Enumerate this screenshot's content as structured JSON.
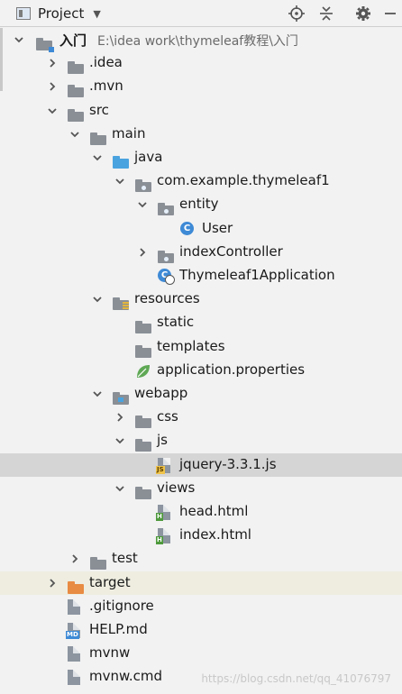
{
  "header": {
    "title": "Project",
    "icons": [
      "crosshair-icon",
      "collapse-icon",
      "gear-icon",
      "minimize-icon"
    ]
  },
  "tree": [
    {
      "label": "入门",
      "path": "E:\\idea work\\thymeleaf教程\\入门",
      "depth": 0,
      "expanded": true,
      "icon": "module-folder"
    },
    {
      "label": ".idea",
      "depth": 1,
      "expanded": false,
      "icon": "folder"
    },
    {
      "label": ".mvn",
      "depth": 1,
      "expanded": false,
      "icon": "folder"
    },
    {
      "label": "src",
      "depth": 1,
      "expanded": true,
      "icon": "folder"
    },
    {
      "label": "main",
      "depth": 2,
      "expanded": true,
      "icon": "folder"
    },
    {
      "label": "java",
      "depth": 3,
      "expanded": true,
      "icon": "source-folder"
    },
    {
      "label": "com.example.thymeleaf1",
      "depth": 4,
      "expanded": true,
      "icon": "package"
    },
    {
      "label": "entity",
      "depth": 5,
      "expanded": true,
      "icon": "package"
    },
    {
      "label": "User",
      "depth": 6,
      "icon": "class"
    },
    {
      "label": "indexController",
      "depth": 5,
      "expanded": false,
      "icon": "package"
    },
    {
      "label": "Thymeleaf1Application",
      "depth": 5,
      "icon": "spring-class"
    },
    {
      "label": "resources",
      "depth": 3,
      "expanded": true,
      "icon": "resources-folder"
    },
    {
      "label": "static",
      "depth": 4,
      "icon": "folder"
    },
    {
      "label": "templates",
      "depth": 4,
      "icon": "folder"
    },
    {
      "label": "application.properties",
      "depth": 4,
      "icon": "spring-leaf"
    },
    {
      "label": "webapp",
      "depth": 3,
      "expanded": true,
      "icon": "web-folder"
    },
    {
      "label": "css",
      "depth": 4,
      "expanded": false,
      "icon": "folder"
    },
    {
      "label": "js",
      "depth": 4,
      "expanded": true,
      "icon": "folder"
    },
    {
      "label": "jquery-3.3.1.js",
      "depth": 5,
      "icon": "js-file",
      "selected": true
    },
    {
      "label": "views",
      "depth": 4,
      "expanded": true,
      "icon": "folder"
    },
    {
      "label": "head.html",
      "depth": 5,
      "icon": "html-file"
    },
    {
      "label": "index.html",
      "depth": 5,
      "icon": "html-file"
    },
    {
      "label": "test",
      "depth": 2,
      "expanded": false,
      "icon": "folder"
    },
    {
      "label": "target",
      "depth": 1,
      "expanded": false,
      "icon": "excluded-folder",
      "highlight": true
    },
    {
      "label": ".gitignore",
      "depth": 1,
      "icon": "text-file"
    },
    {
      "label": "HELP.md",
      "depth": 1,
      "icon": "md-file"
    },
    {
      "label": "mvnw",
      "depth": 1,
      "icon": "text-file"
    },
    {
      "label": "mvnw.cmd",
      "depth": 1,
      "icon": "text-file"
    }
  ],
  "watermark": "https://blog.csdn.net/qq_41076797",
  "colors": {
    "folder": "#8a8f96",
    "source": "#4aa3df",
    "excluded": "#e88b43",
    "class": "#3e8ad6",
    "spring": "#5fa855"
  }
}
